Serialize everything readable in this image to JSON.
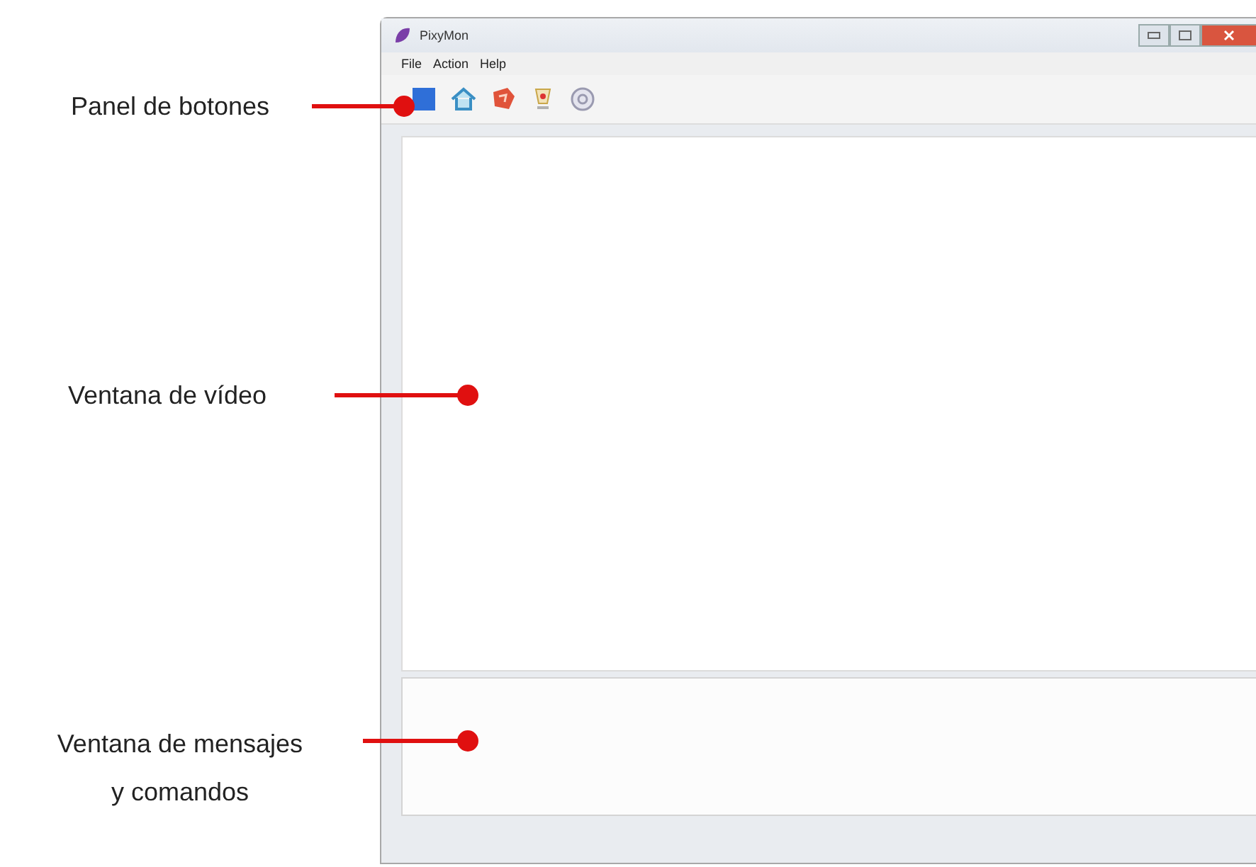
{
  "window": {
    "title": "PixyMon"
  },
  "menu": [
    "File",
    "Action",
    "Help"
  ],
  "annotations": [
    {
      "label": "Panel de botones"
    },
    {
      "label": "Ventana de vídeo"
    },
    {
      "label": "Ventana de mensajes y comandos"
    }
  ]
}
